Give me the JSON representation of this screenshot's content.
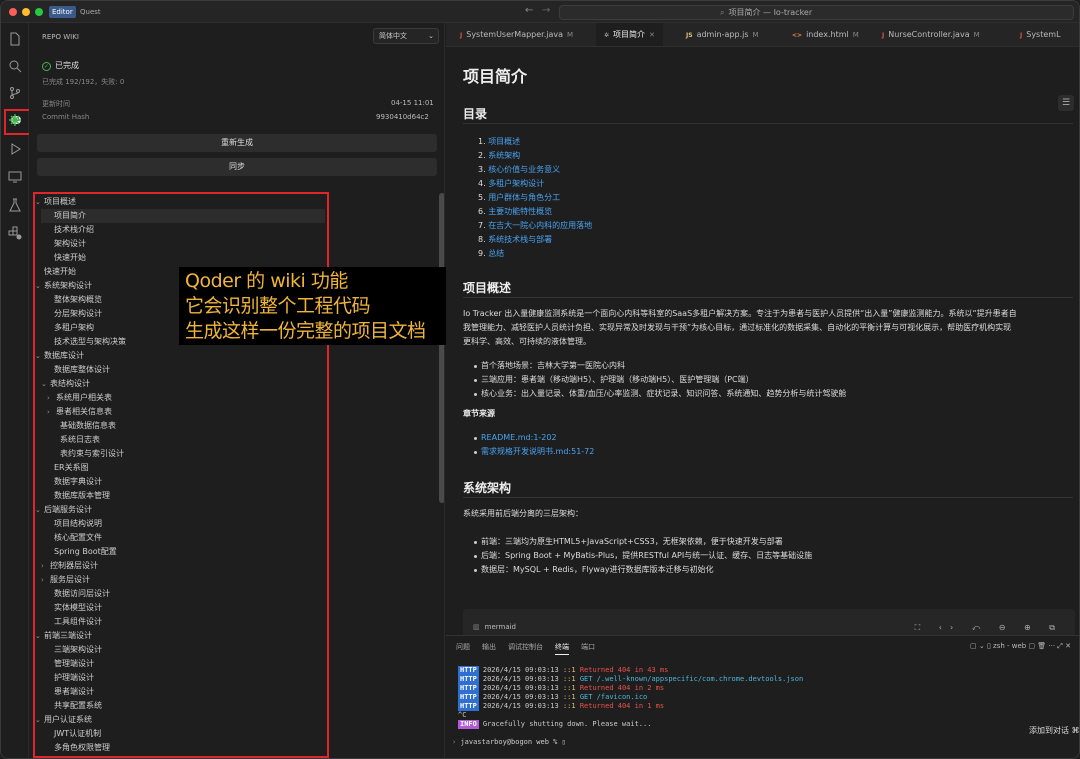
{
  "titlebar": {
    "tag1": "Editor",
    "tag2": "Quest",
    "search": "项目简介 — Io-tracker"
  },
  "activity": {
    "badge": "10"
  },
  "sidebar": {
    "title": "REPO WIKI",
    "language": "简体中文",
    "status": "已完成",
    "progress": "已完成 192/192，失败: 0",
    "updated_label": "更新时间",
    "updated_value": "04-15 11:01",
    "commit_label": "Commit Hash",
    "commit_value": "9930410d64c2",
    "regen": "重新生成",
    "sync": "同步",
    "tree": [
      {
        "label": "项目概述",
        "d": 0,
        "arrow": "⌄"
      },
      {
        "label": "项目简介",
        "d": 1,
        "sel": true
      },
      {
        "label": "技术栈介绍",
        "d": 1
      },
      {
        "label": "架构设计",
        "d": 1
      },
      {
        "label": "快速开始",
        "d": 1
      },
      {
        "label": "快速开始",
        "d": 0
      },
      {
        "label": "系统架构设计",
        "d": 0,
        "arrow": "⌄"
      },
      {
        "label": "整体架构概览",
        "d": 1
      },
      {
        "label": "分层架构设计",
        "d": 1
      },
      {
        "label": "多租户架构",
        "d": 1
      },
      {
        "label": "技术选型与架构决策",
        "d": 1
      },
      {
        "label": "数据库设计",
        "d": 0,
        "arrow": "⌄"
      },
      {
        "label": "数据库整体设计",
        "d": 1
      },
      {
        "label": "表结构设计",
        "d": 1,
        "arrow": "⌄"
      },
      {
        "label": "系统用户相关表",
        "d": 2,
        "arrow": "›"
      },
      {
        "label": "患者相关信息表",
        "d": 2,
        "arrow": "›"
      },
      {
        "label": "基础数据信息表",
        "d": 2
      },
      {
        "label": "系统日志表",
        "d": 2
      },
      {
        "label": "表约束与索引设计",
        "d": 2
      },
      {
        "label": "ER关系图",
        "d": 1
      },
      {
        "label": "数据字典设计",
        "d": 1
      },
      {
        "label": "数据库版本管理",
        "d": 1
      },
      {
        "label": "后端服务设计",
        "d": 0,
        "arrow": "⌄"
      },
      {
        "label": "项目结构说明",
        "d": 1
      },
      {
        "label": "核心配置文件",
        "d": 1
      },
      {
        "label": "Spring Boot配置",
        "d": 1
      },
      {
        "label": "控制器层设计",
        "d": 1,
        "arrow": "›"
      },
      {
        "label": "服务层设计",
        "d": 1,
        "arrow": "›"
      },
      {
        "label": "数据访问层设计",
        "d": 1
      },
      {
        "label": "实体模型设计",
        "d": 1
      },
      {
        "label": "工具组件设计",
        "d": 1
      },
      {
        "label": "前端三端设计",
        "d": 0,
        "arrow": "⌄"
      },
      {
        "label": "三端架构设计",
        "d": 1
      },
      {
        "label": "管理端设计",
        "d": 1
      },
      {
        "label": "护理端设计",
        "d": 1
      },
      {
        "label": "患者端设计",
        "d": 1
      },
      {
        "label": "共享配置系统",
        "d": 1
      },
      {
        "label": "用户认证系统",
        "d": 0,
        "arrow": "⌄"
      },
      {
        "label": "JWT认证机制",
        "d": 1
      },
      {
        "label": "多角色权限管理",
        "d": 1
      }
    ]
  },
  "overlay": {
    "line1": "Qoder 的 wiki 功能",
    "line2": "它会识别整个工程代码",
    "line3": "生成这样一份完整的项目文档"
  },
  "tabs": [
    {
      "label": "SystemUserMapper.java",
      "icon": "J",
      "color": "#e5534b",
      "mod": "M"
    },
    {
      "label": "项目简介",
      "icon": "✲",
      "color": "#bbb",
      "mod": "✕"
    },
    {
      "label": "admin-app.js",
      "icon": "JS",
      "color": "#e5c07b",
      "mod": "M"
    },
    {
      "label": "index.html",
      "icon": "<>",
      "color": "#e8854a",
      "mod": "M"
    },
    {
      "label": "NurseController.java",
      "icon": "J",
      "color": "#e5534b",
      "mod": "M"
    },
    {
      "label": "SystemL",
      "icon": "J",
      "color": "#e5534b",
      "mod": ""
    }
  ],
  "doc": {
    "title": "项目简介",
    "toc_heading": "目录",
    "toc": [
      "项目概述",
      "系统架构",
      "核心价值与业务意义",
      "多租户架构设计",
      "用户群体与角色分工",
      "主要功能特性概览",
      "在吉大一院心内科的应用落地",
      "系统技术栈与部署",
      "总结"
    ],
    "overview_heading": "项目概述",
    "overview_p1": "Io Tracker 出入量健康监测系统是一个面向心内科等科室的SaaS多租户解决方案。专注于为患者与医护人员提供“出入量”健康监测能力。系统以“提升患者自",
    "overview_p2": "我管理能力、减轻医护人员统计负担、实现异常及时发现与干预”为核心目标，通过标准化的数据采集、自动化的平衡计算与可视化展示，帮助医疗机构实现",
    "overview_p3": "更科学、高效、可持续的液体管理。",
    "overview_bullets": [
      "首个落地场景：吉林大学第一医院心内科",
      "三端应用：患者端（移动端H5）、护理端（移动端H5）、医护管理端（PC端）",
      "核心业务：出入量记录、体重/血压/心率监测、症状记录、知识问答、系统通知、趋势分析与统计驾驶舱"
    ],
    "source_heading": "章节来源",
    "sources": [
      "README.md:1-202",
      "需求规格开发说明书.md:51-72"
    ],
    "arch_heading": "系统架构",
    "arch_p": "系统采用前后端分离的三层架构：",
    "arch_bullets": [
      "前端：三端均为原生HTML5+JavaScript+CSS3，无框架依赖，便于快速开发与部署",
      "后端：Spring Boot + MyBatis-Plus，提供RESTful API与统一认证、缓存、日志等基础设施",
      "数据层：MySQL + Redis，Flyway进行数据库版本迁移与初始化"
    ],
    "mermaid": "mermaid",
    "mermaid_tools": "⛶ ‹› ⤺ ⊖ ⊕ ⧉"
  },
  "panel": {
    "tabs": [
      "问题",
      "输出",
      "调试控制台",
      "终端",
      "端口"
    ],
    "right": "▢ ⌄  ▯ zsh - web  ▢  🗑  ···  ⤢  ✕",
    "lines": [
      {
        "tag": "HTTP",
        "time": "2026/4/15 09:03:13",
        "addr": "::1",
        "msg": "Returned 404 in 43 ms",
        "cls": "red"
      },
      {
        "tag": "HTTP",
        "time": "2026/4/15 09:03:13",
        "addr": "::1",
        "msg": "GET /.well-known/appspecific/com.chrome.devtools.json",
        "cls": "cy"
      },
      {
        "tag": "HTTP",
        "time": "2026/4/15 09:03:13",
        "addr": "::1",
        "msg": "Returned 404 in 2 ms",
        "cls": "red"
      },
      {
        "tag": "HTTP",
        "time": "2026/4/15 09:03:13",
        "addr": "::1",
        "msg": "GET /favicon.ico",
        "cls": "cy"
      },
      {
        "tag": "HTTP",
        "time": "2026/4/15 09:03:13",
        "addr": "::1",
        "msg": "Returned 404 in 1 ms",
        "cls": "red"
      }
    ],
    "ctrlc": "^C",
    "info": "INFO",
    "info_msg": "Gracefully shutting down. Please wait...",
    "prompt": "javastarboy@bogon web % ▯",
    "addchat": "添加到对话 ⌘"
  }
}
